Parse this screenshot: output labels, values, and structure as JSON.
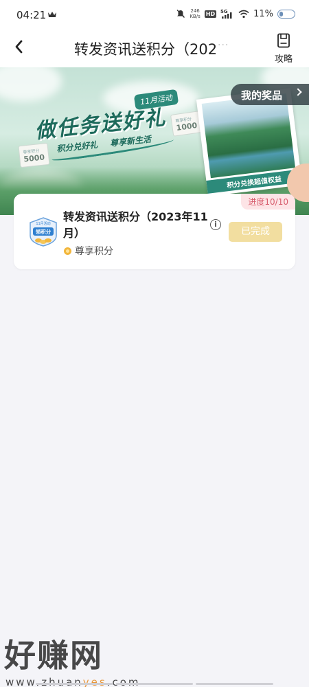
{
  "status_bar": {
    "time": "04:21",
    "network_speed": "246",
    "network_speed_unit": "KB/s",
    "hd_label": "HD",
    "signal_label": "5G",
    "battery": "11%"
  },
  "nav": {
    "title": "转发资讯送积分（202",
    "overflow": "···",
    "guide_label": "攻略"
  },
  "banner": {
    "activity_tag": "11月活动",
    "headline": "做任务送好礼",
    "subline_left": "积分兑好礼",
    "subline_right": "尊享新生活",
    "tag_left_caption": "尊享积分",
    "tag_left_value": "5000",
    "tag_right_caption": "尊享积分",
    "tag_right_value": "1000",
    "photo_caption": "积分兑换超值权益",
    "prize_button": "我的奖品"
  },
  "task": {
    "progress": "进度10/10",
    "badge_top": "11月活动",
    "badge_main": "领积分",
    "title": "转发资讯送积分（2023年11月）",
    "points_label": "尊享积分",
    "info_symbol": "i",
    "status_button": "已完成"
  },
  "watermark": {
    "text": "好赚网",
    "url_left": "www.zhuan",
    "url_highlight": "yes",
    "url_right": ".com"
  },
  "colors": {
    "accent_green": "#2c8a7a",
    "progress_text": "#d85e6e",
    "done_button": "#f2dea0"
  }
}
